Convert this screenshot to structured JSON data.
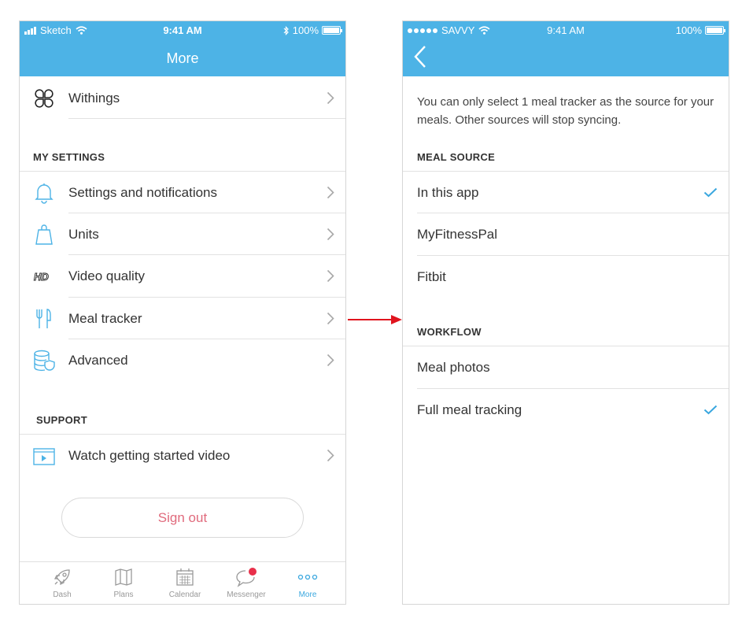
{
  "colors": {
    "accent": "#4db3e6",
    "signout": "#e06a7c",
    "check": "#3aa7df",
    "arrow": "#e0141e"
  },
  "left": {
    "status": {
      "carrier": "Sketch",
      "time": "9:41 AM",
      "battery": "100%"
    },
    "title": "More",
    "top_row": {
      "label": "Withings",
      "icon": "withings-icon"
    },
    "my_settings": {
      "heading": "MY SETTINGS",
      "items": [
        {
          "label": "Settings and notifications",
          "icon": "bell-icon"
        },
        {
          "label": "Units",
          "icon": "scale-icon"
        },
        {
          "label": "Video quality",
          "icon": "hd-icon"
        },
        {
          "label": "Meal tracker",
          "icon": "fork-knife-icon"
        },
        {
          "label": "Advanced",
          "icon": "database-shield-icon"
        }
      ]
    },
    "support": {
      "heading": "SUPPORT",
      "items": [
        {
          "label": "Watch getting started video",
          "icon": "video-icon"
        }
      ]
    },
    "sign_out": "Sign out",
    "tabs": [
      {
        "label": "Dash",
        "icon": "rocket-icon"
      },
      {
        "label": "Plans",
        "icon": "map-icon"
      },
      {
        "label": "Calendar",
        "icon": "calendar-icon"
      },
      {
        "label": "Messenger",
        "icon": "chat-bubble-icon"
      },
      {
        "label": "More",
        "icon": "more-dots-icon",
        "active": true
      }
    ]
  },
  "right": {
    "status": {
      "carrier": "SAVVY",
      "time": "9:41 AM",
      "battery": "100%"
    },
    "description": "You can only select 1 meal tracker as the source for your meals. Other sources will stop syncing.",
    "meal_source": {
      "heading": "MEAL SOURCE",
      "options": [
        {
          "label": "In this app",
          "selected": true
        },
        {
          "label": "MyFitnessPal",
          "selected": false
        },
        {
          "label": "Fitbit",
          "selected": false
        }
      ]
    },
    "workflow": {
      "heading": "WORKFLOW",
      "options": [
        {
          "label": "Meal photos",
          "selected": false
        },
        {
          "label": "Full meal tracking",
          "selected": true
        }
      ]
    }
  }
}
